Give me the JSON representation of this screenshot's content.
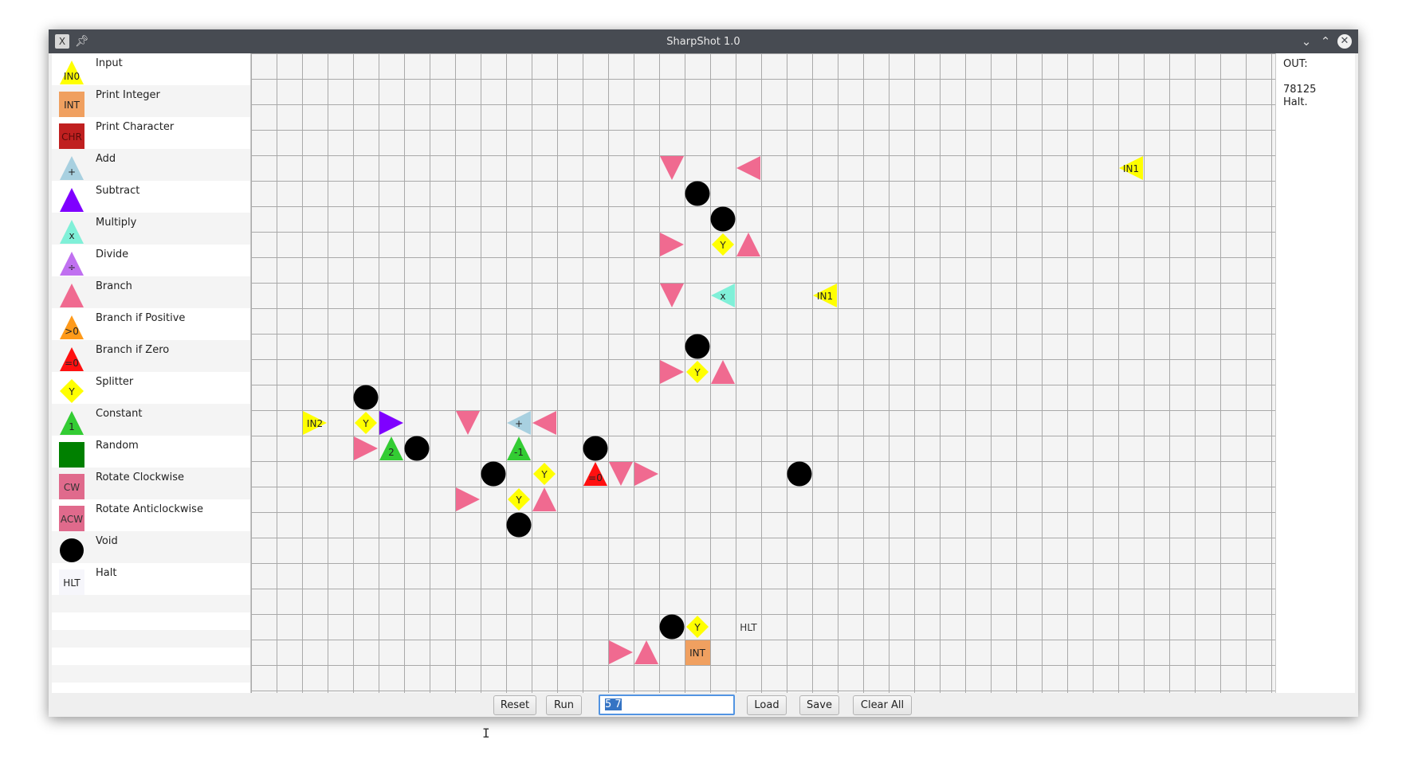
{
  "window": {
    "title": "SharpShot 1.0",
    "app_icon": "X",
    "icons": [
      "app-icon",
      "pin-icon",
      "minimize-icon",
      "maximize-icon",
      "close-icon"
    ]
  },
  "palette": [
    {
      "label": "Input",
      "icon_text": "IN0",
      "shape": "tri-up",
      "color": "#ffff00"
    },
    {
      "label": "Print Integer",
      "icon_text": "INT",
      "shape": "square",
      "color": "#f0a060"
    },
    {
      "label": "Print Character",
      "icon_text": "CHR",
      "shape": "square",
      "color": "#c02020"
    },
    {
      "label": "Add",
      "icon_text": "+",
      "shape": "tri-up",
      "color": "#a8d0e0"
    },
    {
      "label": "Subtract",
      "icon_text": "",
      "shape": "tri-up",
      "color": "#7f00ff"
    },
    {
      "label": "Multiply",
      "icon_text": "x",
      "shape": "tri-up",
      "color": "#80f0d8"
    },
    {
      "label": "Divide",
      "icon_text": "÷",
      "shape": "tri-up",
      "color": "#c070f0"
    },
    {
      "label": "Branch",
      "icon_text": "",
      "shape": "tri-up",
      "color": "#f06a90"
    },
    {
      "label": "Branch if Positive",
      "icon_text": ">0",
      "shape": "tri-up",
      "color": "#ff9a1a"
    },
    {
      "label": "Branch if Zero",
      "icon_text": "=0",
      "shape": "tri-up",
      "color": "#ff1010"
    },
    {
      "label": "Splitter",
      "icon_text": "Y",
      "shape": "diamond",
      "color": "#ffff00"
    },
    {
      "label": "Constant",
      "icon_text": "1",
      "shape": "tri-up",
      "color": "#33cc33"
    },
    {
      "label": "Random",
      "icon_text": "",
      "shape": "square",
      "color": "#008000"
    },
    {
      "label": "Rotate Clockwise",
      "icon_text": "CW",
      "shape": "square",
      "color": "#e06a8c"
    },
    {
      "label": "Rotate Anticlockwise",
      "icon_text": "ACW",
      "shape": "square",
      "color": "#e06a8c"
    },
    {
      "label": "Void",
      "icon_text": "",
      "shape": "circle",
      "color": "#000000"
    },
    {
      "label": "Halt",
      "icon_text": "HLT",
      "shape": "text",
      "color": "#f6f6fb"
    }
  ],
  "grid": {
    "cols": 40,
    "rows": 25,
    "cells": [
      {
        "col": 16,
        "row": 4,
        "type": "branch",
        "dir": "down"
      },
      {
        "col": 19,
        "row": 4,
        "type": "branch",
        "dir": "left"
      },
      {
        "col": 34,
        "row": 4,
        "type": "input",
        "dir": "left",
        "text": "IN1"
      },
      {
        "col": 17,
        "row": 5,
        "type": "void"
      },
      {
        "col": 18,
        "row": 6,
        "type": "void"
      },
      {
        "col": 16,
        "row": 7,
        "type": "branch",
        "dir": "right"
      },
      {
        "col": 18,
        "row": 7,
        "type": "splitter",
        "text": "Y"
      },
      {
        "col": 19,
        "row": 7,
        "type": "branch",
        "dir": "up"
      },
      {
        "col": 16,
        "row": 9,
        "type": "branch",
        "dir": "down"
      },
      {
        "col": 18,
        "row": 9,
        "type": "multiply",
        "dir": "left",
        "text": "x"
      },
      {
        "col": 22,
        "row": 9,
        "type": "input",
        "dir": "left",
        "text": "IN1"
      },
      {
        "col": 17,
        "row": 11,
        "type": "void"
      },
      {
        "col": 16,
        "row": 12,
        "type": "branch",
        "dir": "right"
      },
      {
        "col": 17,
        "row": 12,
        "type": "splitter",
        "text": "Y"
      },
      {
        "col": 18,
        "row": 12,
        "type": "branch",
        "dir": "up"
      },
      {
        "col": 4,
        "row": 13,
        "type": "void"
      },
      {
        "col": 2,
        "row": 14,
        "type": "input",
        "dir": "right",
        "text": "IN2"
      },
      {
        "col": 4,
        "row": 14,
        "type": "splitter",
        "text": "Y"
      },
      {
        "col": 5,
        "row": 14,
        "type": "subtract",
        "dir": "right"
      },
      {
        "col": 8,
        "row": 14,
        "type": "branch",
        "dir": "down"
      },
      {
        "col": 10,
        "row": 14,
        "type": "add",
        "dir": "left",
        "text": "+"
      },
      {
        "col": 11,
        "row": 14,
        "type": "branch",
        "dir": "left"
      },
      {
        "col": 4,
        "row": 15,
        "type": "branch",
        "dir": "right"
      },
      {
        "col": 5,
        "row": 15,
        "type": "constant",
        "dir": "up",
        "text": "2"
      },
      {
        "col": 6,
        "row": 15,
        "type": "void"
      },
      {
        "col": 10,
        "row": 15,
        "type": "constant",
        "dir": "up",
        "text": "-1"
      },
      {
        "col": 13,
        "row": 15,
        "type": "void"
      },
      {
        "col": 9,
        "row": 16,
        "type": "void"
      },
      {
        "col": 11,
        "row": 16,
        "type": "splitter",
        "text": "Y"
      },
      {
        "col": 13,
        "row": 16,
        "type": "branchzero",
        "dir": "up",
        "text": "=0"
      },
      {
        "col": 14,
        "row": 16,
        "type": "branch",
        "dir": "down"
      },
      {
        "col": 15,
        "row": 16,
        "type": "branch",
        "dir": "right"
      },
      {
        "col": 21,
        "row": 16,
        "type": "void"
      },
      {
        "col": 8,
        "row": 17,
        "type": "branch",
        "dir": "right"
      },
      {
        "col": 10,
        "row": 17,
        "type": "splitter",
        "text": "Y"
      },
      {
        "col": 11,
        "row": 17,
        "type": "branch",
        "dir": "up"
      },
      {
        "col": 10,
        "row": 18,
        "type": "void"
      },
      {
        "col": 16,
        "row": 22,
        "type": "void"
      },
      {
        "col": 17,
        "row": 22,
        "type": "splitter",
        "text": "Y"
      },
      {
        "col": 19,
        "row": 22,
        "type": "halt",
        "text": "HLT"
      },
      {
        "col": 14,
        "row": 23,
        "type": "branch",
        "dir": "right"
      },
      {
        "col": 15,
        "row": 23,
        "type": "branch",
        "dir": "up"
      },
      {
        "col": 17,
        "row": 23,
        "type": "printint",
        "text": "INT"
      }
    ]
  },
  "colors": {
    "branch": "#f06a90",
    "input": "#ffff00",
    "void": "#000000",
    "splitter": "#ffff00",
    "multiply": "#80f0d8",
    "add": "#a8d0e0",
    "subtract": "#7f00ff",
    "constant": "#33cc33",
    "branchzero": "#ff1010",
    "printint": "#f0a060",
    "halt": "#f4f4f4"
  },
  "output": {
    "label": "OUT:",
    "lines": [
      "78125",
      "Halt."
    ]
  },
  "toolbar": {
    "reset": "Reset",
    "run": "Run",
    "input_value": "5 7",
    "load": "Load",
    "save": "Save",
    "clear_all": "Clear All"
  }
}
